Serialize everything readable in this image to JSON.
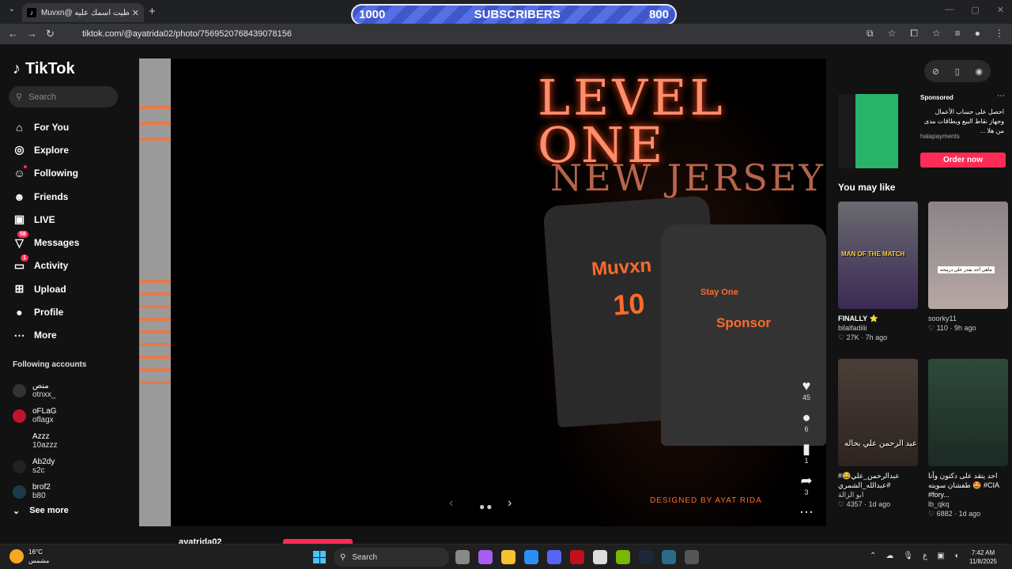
{
  "browser": {
    "tab_title": "Muvxn@ حطيت اسمك عليه",
    "tab_close": "✕",
    "new_tab": "+",
    "url": "tiktok.com/@ayatrida02/photo/7569520768439078156"
  },
  "overlay": {
    "left_count": "1000",
    "label": "SUBSCRIBERS",
    "right_count": "800"
  },
  "tiktok": {
    "logo": "TikTok",
    "search_placeholder": "Search",
    "nav": [
      {
        "label": "For You",
        "icon": "home-icon"
      },
      {
        "label": "Explore",
        "icon": "compass-icon"
      },
      {
        "label": "Following",
        "icon": "user-follow-icon"
      },
      {
        "label": "Friends",
        "icon": "friends-icon"
      },
      {
        "label": "LIVE",
        "icon": "live-icon"
      },
      {
        "label": "Messages",
        "icon": "send-icon",
        "badge": "58"
      },
      {
        "label": "Activity",
        "icon": "bell-icon",
        "badge": "1"
      },
      {
        "label": "Upload",
        "icon": "plus-square-icon"
      },
      {
        "label": "Profile",
        "icon": "avatar-icon"
      },
      {
        "label": "More",
        "icon": "ellipsis-icon"
      }
    ],
    "following_title": "Following accounts",
    "following": [
      {
        "name": "منص",
        "user": "otnxx_"
      },
      {
        "name": "oFLaG",
        "user": "oflagx"
      },
      {
        "name": "Azzz",
        "user": "10azzz"
      },
      {
        "name": "Ab2dy",
        "user": "s2c"
      },
      {
        "name": "brof2",
        "user": "b80"
      }
    ],
    "see_more": "See more"
  },
  "post": {
    "poster_title": "LEVEL ONE",
    "poster_sub": "NEW JERSEY",
    "jersey_name": "Muvxn",
    "jersey_number": "10",
    "jersey_front_1": "Stay One",
    "jersey_front_2": "Sponsor",
    "designed_by": "DESIGNED BY AYAT RIDA",
    "likes": "45",
    "comments": "6",
    "saves": "1",
    "shares": "3",
    "author": "ayatrida02"
  },
  "sidebar_right": {
    "sponsored": "Sponsored",
    "ad_text": "احصل على حساب الأعمال وجهاز نقاط البيع وبطاقات مدى من هلا ...",
    "ad_handle": "halapayments",
    "order_button": "Order now",
    "you_may_like": "You may like",
    "cards": [
      {
        "title": "FINALLY ⭐",
        "user": "bilalfadilii",
        "likes": "27K",
        "age": "7h ago",
        "caption": "MAN OF THE MATCH"
      },
      {
        "title": "",
        "user": "soorky11",
        "likes": "110",
        "age": "9h ago",
        "caption": "ماهي أحد يقدر علي دريبحه"
      },
      {
        "title": "#عبدالرحمن_علي😂 #عبدالله_الشمري",
        "user": "ابو الزالة",
        "likes": "4357",
        "age": "1d ago",
        "caption": "عبد الرحمن علي بحاله"
      },
      {
        "title": "احد يتقد على دكتون وأنا طفشان سويته 🤩 #CIA #fory...",
        "user": "lb_qkq",
        "likes": "6882",
        "age": "1d ago",
        "caption": ""
      }
    ]
  },
  "taskbar": {
    "temp": "16°C",
    "weather": "مشمس",
    "search": "Search",
    "time": "7:42 AM",
    "date": "11/8/2025",
    "lang": "ع"
  }
}
